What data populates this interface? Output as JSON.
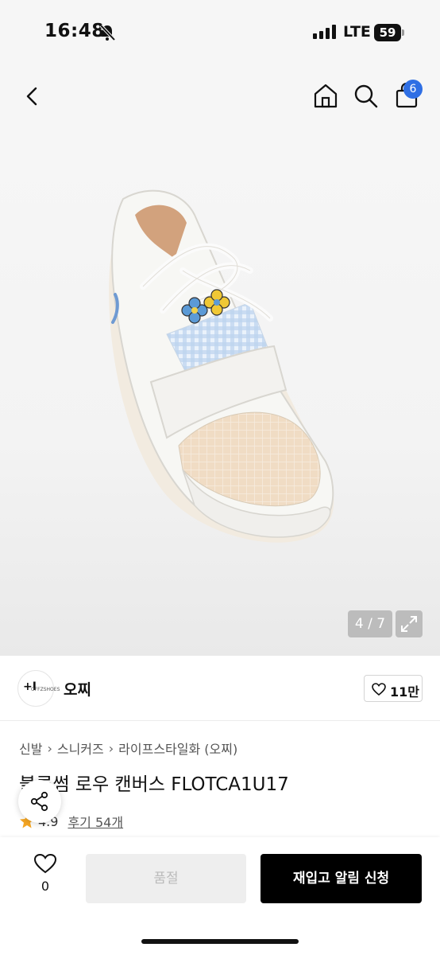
{
  "status_bar": {
    "time": "16:48",
    "network": "LTE",
    "battery": "59",
    "icons": [
      "bell-muted-icon",
      "signal-icon",
      "battery-icon"
    ]
  },
  "nav": {
    "icons": [
      "back-icon",
      "home-icon",
      "search-icon",
      "shopping-bag-icon"
    ],
    "cart_count": "6"
  },
  "gallery": {
    "counter": "4 / 7",
    "icons": [
      "expand-icon"
    ]
  },
  "brand": {
    "logo_text": "+I",
    "logo_sub": "OFFZSHOES",
    "name": "오찌",
    "like_count": "11만"
  },
  "product": {
    "breadcrumb": [
      "신발",
      "스니커즈",
      "라이프스타일화 (오찌)"
    ],
    "title": "블루썸 로우 캔버스 FLOTCA1U17",
    "rating": "4.9",
    "reviews": "후기 54개"
  },
  "bottom": {
    "wish_count": "0",
    "soldout_label": "품절",
    "restock_label": "재입고 알림 신청"
  },
  "colors": {
    "accent_badge": "#2f6fe4",
    "star": "#f5a623",
    "primary_button": "#000000"
  }
}
